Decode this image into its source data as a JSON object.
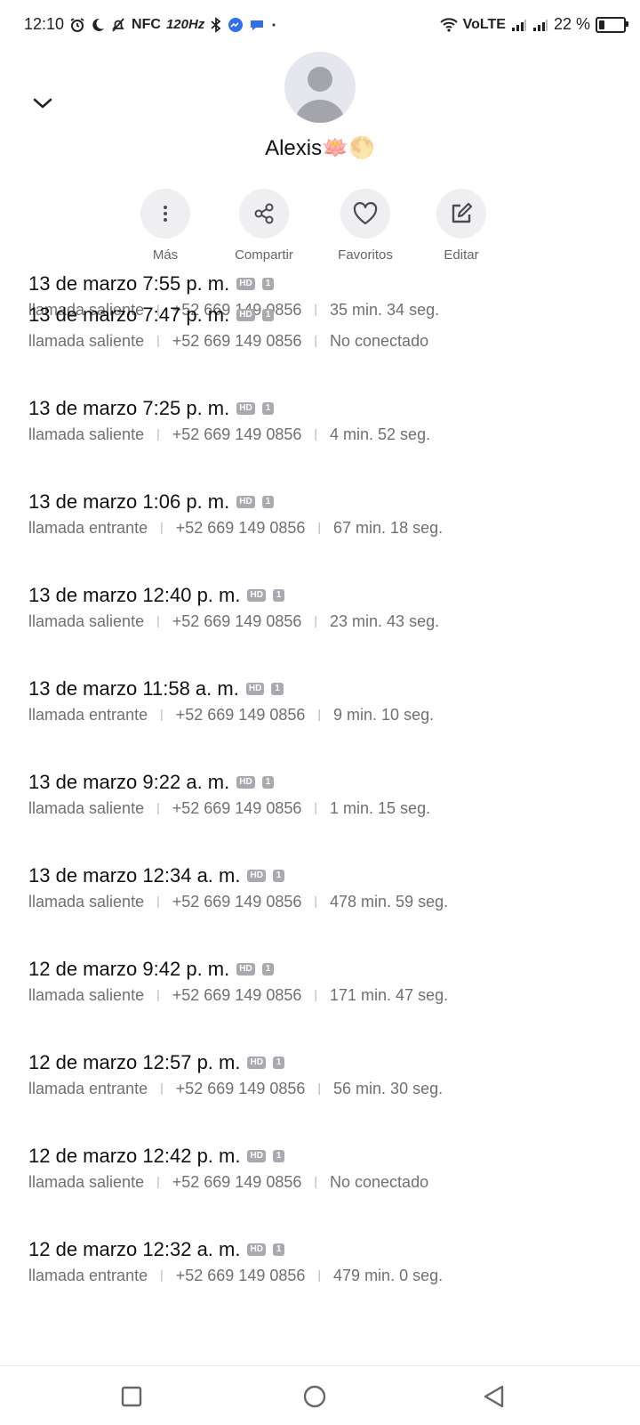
{
  "status_bar": {
    "time": "12:10",
    "nfc": "NFC",
    "refresh": "120Hz",
    "network": "VoLTE",
    "battery_percent": "22 %",
    "battery_level": 0.22
  },
  "contact": {
    "name": "Alexis🪷🌕"
  },
  "actions": [
    {
      "label": "Más",
      "icon": "more-vertical-icon"
    },
    {
      "label": "Compartir",
      "icon": "share-icon"
    },
    {
      "label": "Favoritos",
      "icon": "heart-icon"
    },
    {
      "label": "Editar",
      "icon": "edit-icon"
    }
  ],
  "call_log": [
    {
      "date": "13 de marzo 7:55 p. m.",
      "type": "llamada saliente",
      "number": "+52 669 149 0856",
      "duration": "35 min. 34 seg."
    },
    {
      "date": "13 de marzo 7:47 p. m.",
      "type": "llamada saliente",
      "number": "+52 669 149 0856",
      "duration": "No conectado"
    },
    {
      "date": "13 de marzo 7:25 p. m.",
      "type": "llamada saliente",
      "number": "+52 669 149 0856",
      "duration": "4 min. 52 seg."
    },
    {
      "date": "13 de marzo 1:06 p. m.",
      "type": "llamada entrante",
      "number": "+52 669 149 0856",
      "duration": "67 min. 18 seg."
    },
    {
      "date": "13 de marzo 12:40 p. m.",
      "type": "llamada saliente",
      "number": "+52 669 149 0856",
      "duration": "23 min. 43 seg."
    },
    {
      "date": "13 de marzo 11:58 a. m.",
      "type": "llamada entrante",
      "number": "+52 669 149 0856",
      "duration": "9 min. 10 seg."
    },
    {
      "date": "13 de marzo 9:22 a. m.",
      "type": "llamada saliente",
      "number": "+52 669 149 0856",
      "duration": "1 min. 15 seg."
    },
    {
      "date": "13 de marzo 12:34 a. m.",
      "type": "llamada saliente",
      "number": "+52 669 149 0856",
      "duration": "478 min. 59 seg."
    },
    {
      "date": "12 de marzo 9:42 p. m.",
      "type": "llamada saliente",
      "number": "+52 669 149 0856",
      "duration": "171 min. 47 seg."
    },
    {
      "date": "12 de marzo 12:57 p. m.",
      "type": "llamada entrante",
      "number": "+52 669 149 0856",
      "duration": "56 min. 30 seg."
    },
    {
      "date": "12 de marzo 12:42 p. m.",
      "type": "llamada saliente",
      "number": "+52 669 149 0856",
      "duration": "No conectado"
    },
    {
      "date": "12 de marzo 12:32 a. m.",
      "type": "llamada entrante",
      "number": "+52 669 149 0856",
      "duration": "479 min. 0 seg."
    }
  ],
  "badges": {
    "hd": "HD",
    "sim": "1"
  },
  "colors": {
    "icon": "#4a4a52",
    "secondary_text": "#707070",
    "action_bg": "#efeff2"
  }
}
